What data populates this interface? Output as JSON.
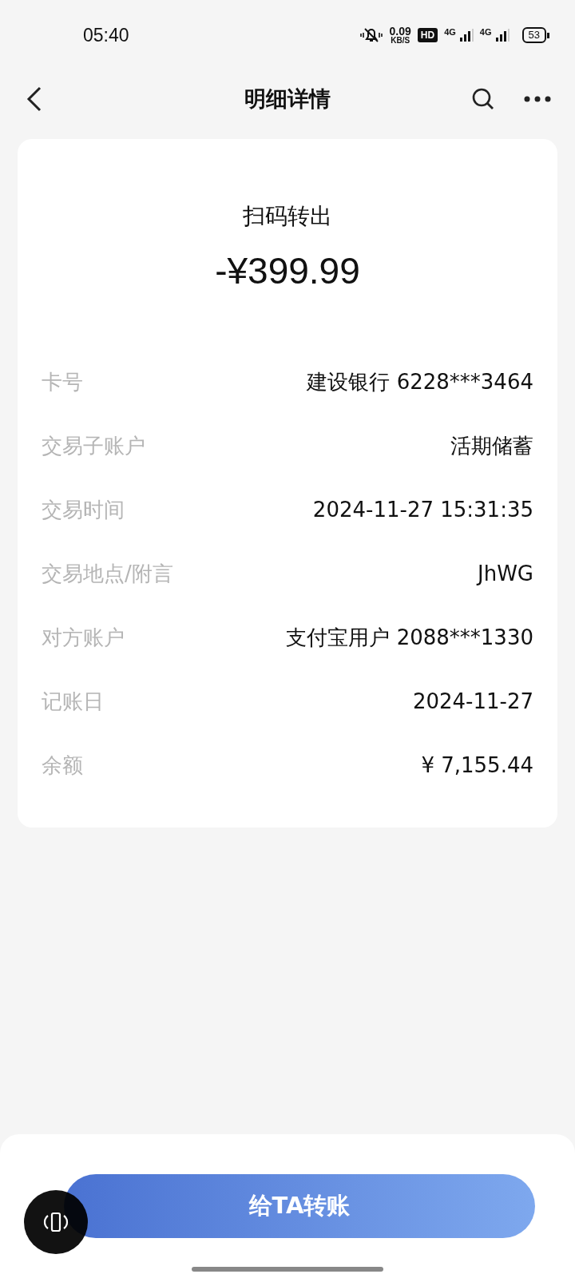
{
  "status_bar": {
    "time": "05:40",
    "speed": "0.09",
    "speed_unit": "KB/S",
    "hd_badge": "HD",
    "network_1": "4G",
    "network_2": "4G",
    "battery": "53"
  },
  "nav": {
    "title": "明细详情"
  },
  "transaction": {
    "type": "扫码转出",
    "amount": "-¥399.99"
  },
  "details": [
    {
      "label": "卡号",
      "value": "建设银行 6228***3464"
    },
    {
      "label": "交易子账户",
      "value": "活期储蓄"
    },
    {
      "label": "交易时间",
      "value": "2024-11-27 15:31:35"
    },
    {
      "label": "交易地点/附言",
      "value": "JhWG"
    },
    {
      "label": "对方账户",
      "value": "支付宝用户 2088***1330"
    },
    {
      "label": "记账日",
      "value": "2024-11-27"
    },
    {
      "label": "余额",
      "value": "¥ 7,155.44"
    }
  ],
  "action_button": "给TA转账"
}
